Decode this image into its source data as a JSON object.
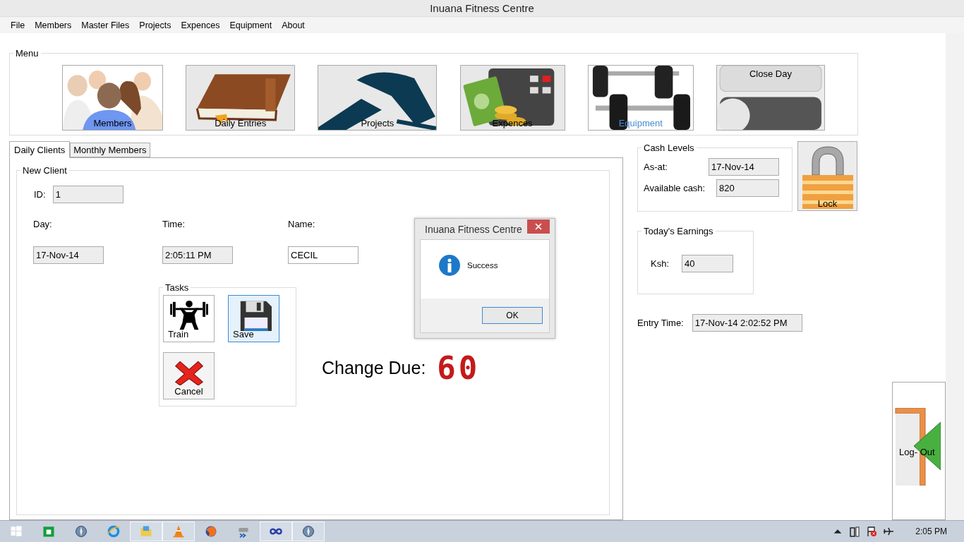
{
  "window": {
    "title": "Inuana Fitness Centre"
  },
  "menu_bar": [
    "File",
    "Members",
    "Master Files",
    "Projects",
    "Expences",
    "Equipment",
    "About"
  ],
  "menu_panel": {
    "title": "Menu",
    "tiles": [
      {
        "label": "Members",
        "kind": "people",
        "hovered": false
      },
      {
        "label": "Daily Entries",
        "kind": "book",
        "hovered": false
      },
      {
        "label": "Projects",
        "kind": "tools",
        "hovered": false
      },
      {
        "label": "Expences",
        "kind": "money",
        "hovered": false
      },
      {
        "label": "Equipment",
        "kind": "dumbbell",
        "hovered": true
      },
      {
        "label": "Close Day",
        "kind": "switch",
        "hovered": false
      }
    ]
  },
  "tabs": [
    {
      "label": "Daily Clients",
      "selected": true
    },
    {
      "label": "Monthly Members",
      "selected": false
    }
  ],
  "new_client": {
    "title": "New Client",
    "id": {
      "label": "ID:",
      "value": "1"
    },
    "fields": [
      {
        "label": "Day:",
        "value": "17-Nov-14",
        "readonly": true
      },
      {
        "label": "Time:",
        "value": "2:05:11 PM",
        "readonly": true
      },
      {
        "label": "Name:",
        "value": "CECIL",
        "readonly": false
      }
    ],
    "tasks": {
      "title": "Tasks",
      "buttons": [
        {
          "label": "Train",
          "kind": "train",
          "focused": false
        },
        {
          "label": "Save",
          "kind": "save",
          "focused": true
        },
        {
          "label": "Cancel",
          "kind": "cancel",
          "focused": false
        }
      ]
    },
    "change_due": {
      "label": "Change Due:",
      "value": "60"
    }
  },
  "cash_levels": {
    "title": "Cash Levels",
    "rows": [
      {
        "label": "As-at:",
        "value": "17-Nov-14"
      },
      {
        "label": "Available cash:",
        "value": "820"
      }
    ]
  },
  "lock_button": {
    "label": "Lock"
  },
  "todays_earnings": {
    "title": "Today's Earnings",
    "label": "Ksh:",
    "value": "40"
  },
  "entry_time": {
    "label": "Entry Time:",
    "value": "17-Nov-14 2:02:52 PM"
  },
  "logout_button": {
    "label": "Log- Out"
  },
  "dialog": {
    "title": "Inuana Fitness Centre",
    "message": "Success",
    "button": "OK"
  },
  "taskbar": {
    "apps": [
      {
        "kind": "start",
        "active": false
      },
      {
        "kind": "store",
        "active": false
      },
      {
        "kind": "compass",
        "active": false
      },
      {
        "kind": "browser-e",
        "active": false
      },
      {
        "kind": "folder",
        "active": true
      },
      {
        "kind": "cone",
        "active": true
      },
      {
        "kind": "globe",
        "active": false
      },
      {
        "kind": "device",
        "active": false
      },
      {
        "kind": "infinity",
        "active": true
      },
      {
        "kind": "compass",
        "active": true
      }
    ],
    "clock": "2:05 PM"
  }
}
